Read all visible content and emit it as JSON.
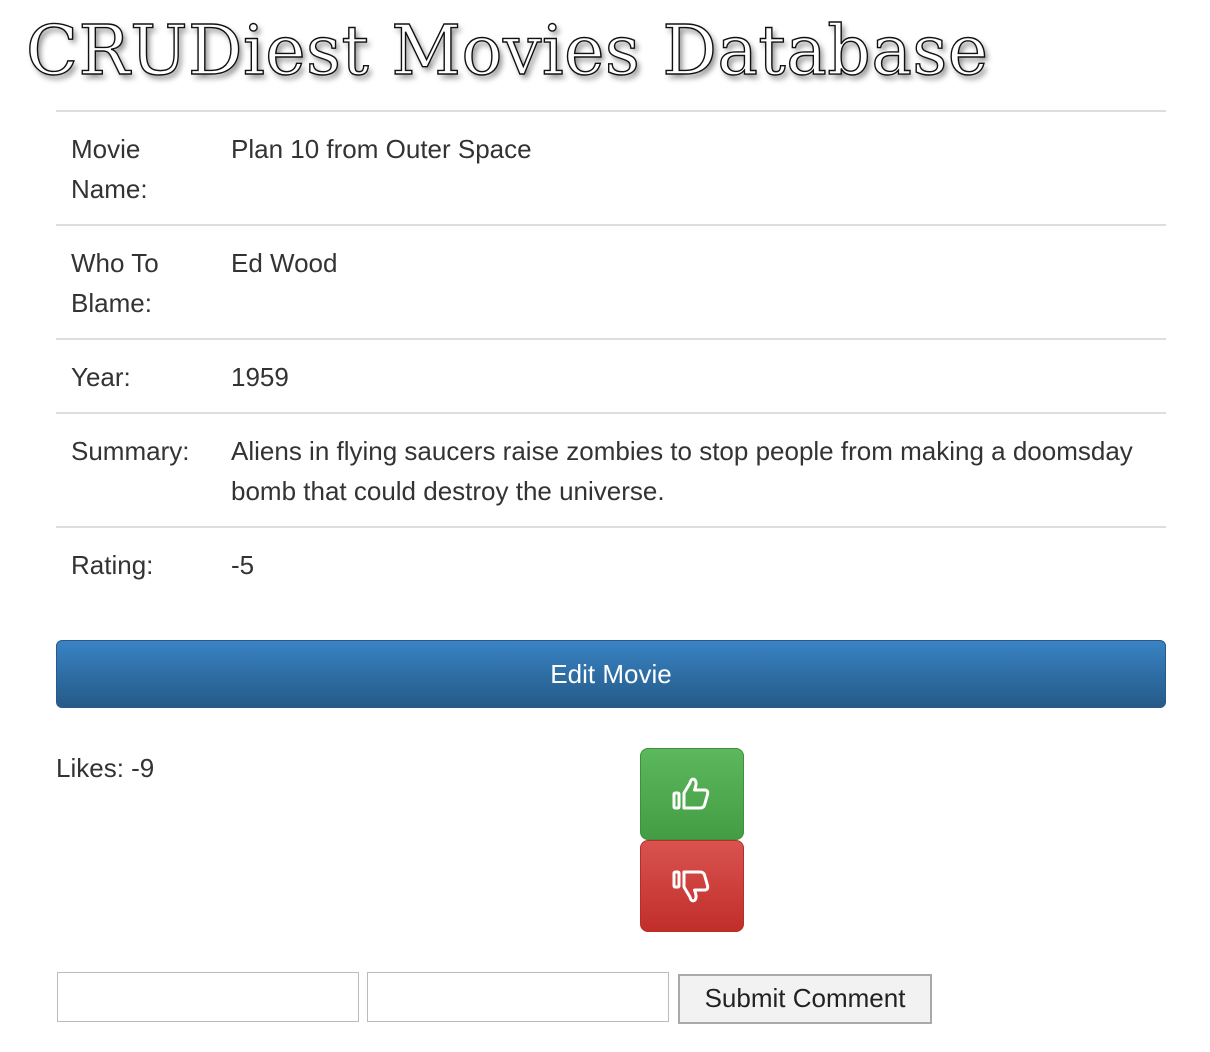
{
  "header": {
    "title": "CRUDiest Movies Database"
  },
  "movie": {
    "rows": [
      {
        "label": "Movie Name:",
        "value": "Plan 10 from Outer Space"
      },
      {
        "label": "Who To Blame:",
        "value": "Ed Wood"
      },
      {
        "label": "Year:",
        "value": "1959"
      },
      {
        "label": "Summary:",
        "value": "Aliens in flying saucers raise zombies to stop people from making a doomsday bomb that could destroy the universe."
      },
      {
        "label": "Rating:",
        "value": "-5"
      }
    ]
  },
  "actions": {
    "edit_label": "Edit Movie"
  },
  "likes": {
    "text": "Likes: -9",
    "like_icon": "thumbs-up-icon",
    "dislike_icon": "thumbs-down-icon",
    "like_color": "#5cb85c",
    "dislike_color": "#d9534f"
  },
  "comment_form": {
    "name_value": "",
    "comment_value": "",
    "submit_label": "Submit Comment"
  }
}
